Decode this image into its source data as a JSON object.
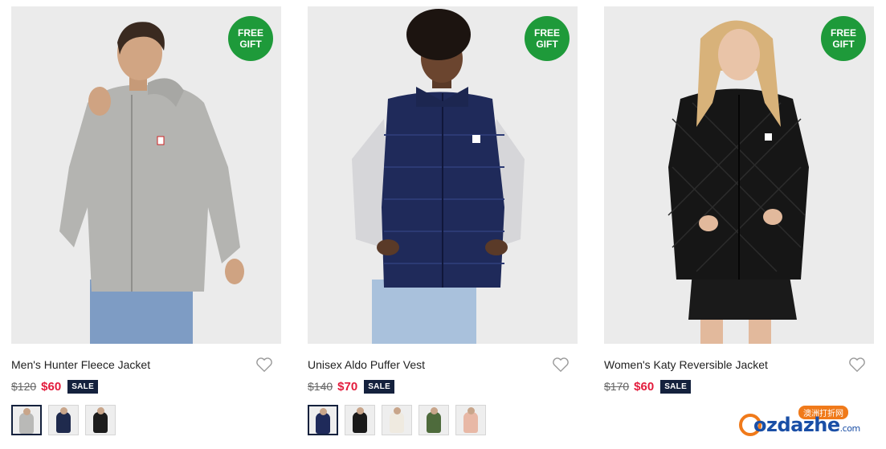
{
  "products": [
    {
      "name": "Men's Hunter Fleece Jacket",
      "old_price": "$120",
      "new_price": "$60",
      "sale_badge": "SALE",
      "gift_line1": "FREE",
      "gift_line2": "GIFT",
      "swatch_colors": [
        "#b9b9b7",
        "#1f2a4d",
        "#1c1c1c"
      ],
      "selected_swatch": 0
    },
    {
      "name": "Unisex Aldo Puffer Vest",
      "old_price": "$140",
      "new_price": "$70",
      "sale_badge": "SALE",
      "gift_line1": "FREE",
      "gift_line2": "GIFT",
      "swatch_colors": [
        "#1f2a5a",
        "#1a1a1a",
        "#efeae0",
        "#4e6b3c",
        "#e8b8a6"
      ],
      "selected_swatch": 0
    },
    {
      "name": "Women's Katy Reversible Jacket",
      "old_price": "$170",
      "new_price": "$60",
      "sale_badge": "SALE",
      "gift_line1": "FREE",
      "gift_line2": "GIFT",
      "swatch_colors": [],
      "selected_swatch": -1
    }
  ],
  "colors": {
    "gift_badge": "#1e9a3a",
    "sale_price": "#e31b3c",
    "sale_badge": "#14213d"
  },
  "watermark": {
    "brand_main": "ozdazhe",
    "brand_tld": ".com",
    "brand_cn": "澳洲打折网"
  }
}
